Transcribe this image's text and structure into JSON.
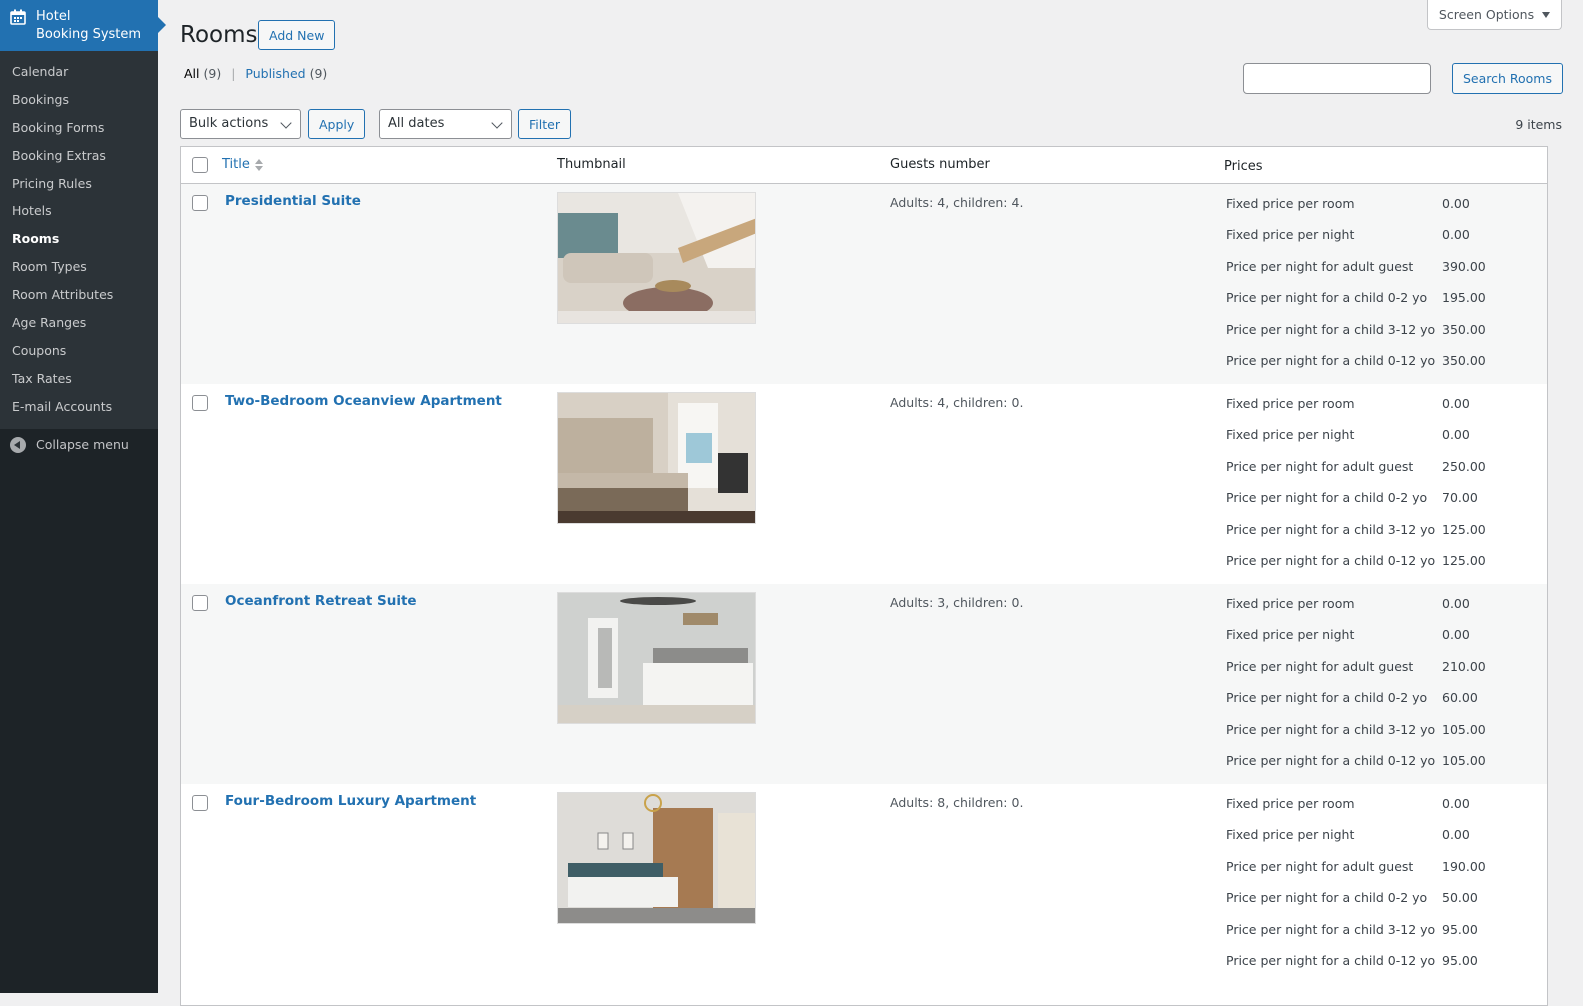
{
  "app": {
    "brand_line1": "Hotel",
    "brand_line2": "Booking System"
  },
  "sidebar": {
    "items": [
      {
        "label": "Calendar"
      },
      {
        "label": "Bookings"
      },
      {
        "label": "Booking Forms"
      },
      {
        "label": "Booking Extras"
      },
      {
        "label": "Pricing Rules"
      },
      {
        "label": "Hotels"
      },
      {
        "label": "Rooms"
      },
      {
        "label": "Room Types"
      },
      {
        "label": "Room Attributes"
      },
      {
        "label": "Age Ranges"
      },
      {
        "label": "Coupons"
      },
      {
        "label": "Tax Rates"
      },
      {
        "label": "E-mail Accounts"
      }
    ],
    "current": "Rooms",
    "collapse_label": "Collapse menu"
  },
  "header": {
    "screen_options": "Screen Options",
    "title": "Rooms",
    "add_new": "Add New"
  },
  "views": {
    "all_label": "All",
    "all_count": "(9)",
    "sep": "|",
    "published_label": "Published",
    "published_count": "(9)"
  },
  "search": {
    "value": "",
    "button": "Search Rooms"
  },
  "toolbar": {
    "bulk_actions": "Bulk actions",
    "apply": "Apply",
    "dates": "All dates",
    "filter": "Filter",
    "items_count": "9 items"
  },
  "table": {
    "columns": {
      "title": "Title",
      "thumbnail": "Thumbnail",
      "guests": "Guests number",
      "prices": "Prices"
    },
    "price_labels": [
      "Fixed price per room",
      "Fixed price per night",
      "Price per night for adult guest",
      "Price per night for a child 0-2 yo",
      "Price per night for a child 3-12 yo",
      "Price per night for a child 0-12 yo"
    ],
    "rows": [
      {
        "title": "Presidential Suite",
        "guests": "Adults: 4, children: 4.",
        "thumb": "living-room-photo",
        "prices": [
          "0.00",
          "0.00",
          "390.00",
          "195.00",
          "350.00",
          "350.00"
        ]
      },
      {
        "title": "Two-Bedroom Oceanview Apartment",
        "guests": "Adults: 4, children: 0.",
        "thumb": "bedroom-balcony-photo",
        "prices": [
          "0.00",
          "0.00",
          "250.00",
          "70.00",
          "125.00",
          "125.00"
        ]
      },
      {
        "title": "Oceanfront Retreat Suite",
        "guests": "Adults: 3, children: 0.",
        "thumb": "bedroom-fan-photo",
        "prices": [
          "0.00",
          "0.00",
          "210.00",
          "60.00",
          "105.00",
          "105.00"
        ]
      },
      {
        "title": "Four-Bedroom Luxury Apartment",
        "guests": "Adults: 8, children: 0.",
        "thumb": "bedroom-chandelier-photo",
        "prices": [
          "0.00",
          "0.00",
          "190.00",
          "50.00",
          "95.00",
          "95.00"
        ]
      }
    ]
  },
  "colors": {
    "accent": "#2271b1",
    "sidebar": "#1d2327",
    "submenu": "#2c3338",
    "background": "#f0f0f1"
  }
}
